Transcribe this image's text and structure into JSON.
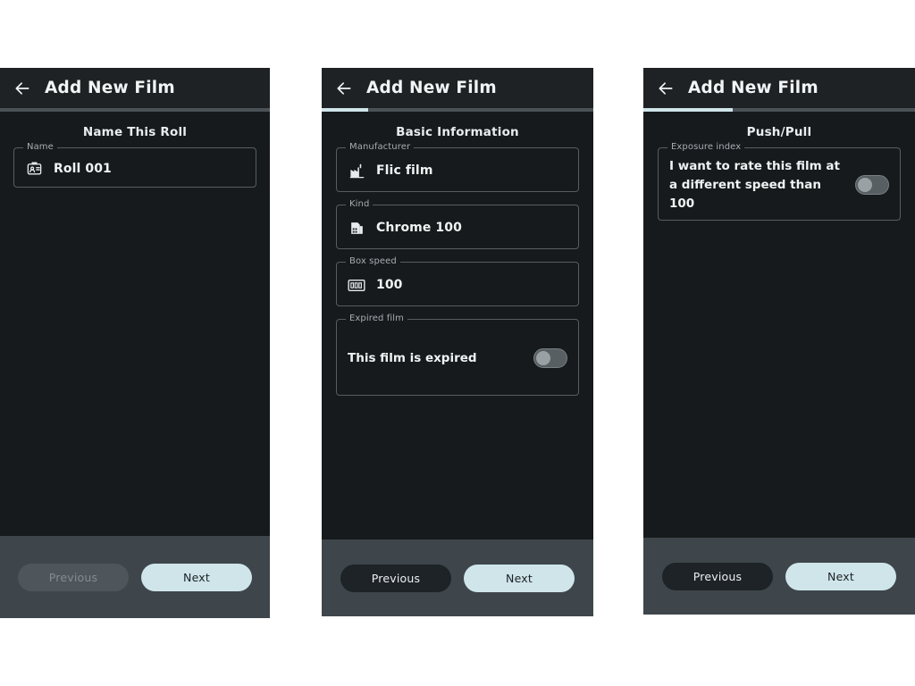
{
  "app": {
    "title": "Add New Film",
    "back_icon": "arrow-left-icon"
  },
  "panels": [
    {
      "id": "name-this-roll",
      "appbar_title": "Add New Film",
      "progress_percent": 0,
      "section_title": "Name This Roll",
      "fields": [
        {
          "legend": "Name",
          "icon": "badge-icon",
          "value": "Roll 001",
          "type": "text"
        }
      ],
      "previous_label": "Previous",
      "previous_enabled": false,
      "next_label": "Next"
    },
    {
      "id": "basic-information",
      "appbar_title": "Add New Film",
      "progress_percent": 17,
      "section_title": "Basic Information",
      "fields": [
        {
          "legend": "Manufacturer",
          "icon": "factory-icon",
          "value": "Flic film",
          "type": "text"
        },
        {
          "legend": "Kind",
          "icon": "film-roll-icon",
          "value": "Chrome 100",
          "type": "text"
        },
        {
          "legend": "Box speed",
          "icon": "iso-box-icon",
          "value": "100",
          "type": "text"
        },
        {
          "legend": "Expired film",
          "toggle_label": "This film is expired",
          "toggle_on": false,
          "type": "toggle"
        }
      ],
      "previous_label": "Previous",
      "previous_enabled": true,
      "next_label": "Next"
    },
    {
      "id": "push-pull",
      "appbar_title": "Add New Film",
      "progress_percent": 33,
      "section_title": "Push/Pull",
      "fields": [
        {
          "legend": "Exposure index",
          "toggle_label": "I want to rate this film at a different speed than 100",
          "toggle_on": false,
          "type": "toggle"
        }
      ],
      "previous_label": "Previous",
      "previous_enabled": true,
      "next_label": "Next"
    }
  ],
  "colors": {
    "accent": "#cfe5ea",
    "panel_bg": "#161a1c",
    "appbar_bg": "#1e2224",
    "bottom_bar_bg": "#3e464b",
    "field_border": "#565d61",
    "legend_text": "#a6adb1",
    "value_text": "#f0f3f4"
  }
}
